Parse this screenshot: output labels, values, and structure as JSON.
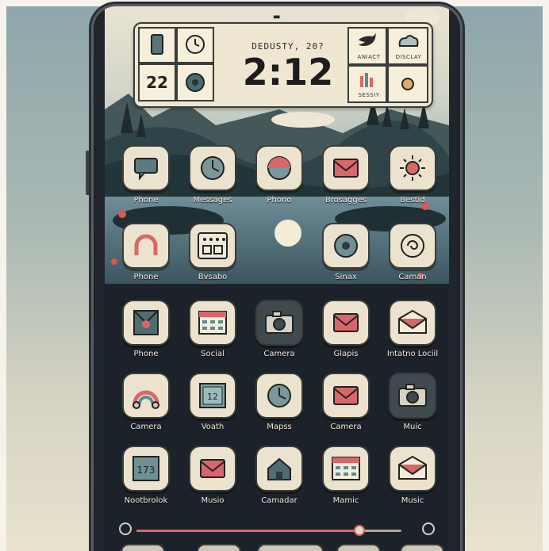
{
  "widget": {
    "date": "DEDUSTY, 20?",
    "time": "2:12",
    "calendar_day": "22",
    "right_top_label": "ANIACT",
    "right_top2_label": "DISCLAY",
    "right_bottom_label": "SESSIY"
  },
  "rows": [
    [
      {
        "label": "Phone",
        "icon": "chat-bubble-icon"
      },
      {
        "label": "Messages",
        "icon": "clock-icon"
      },
      {
        "label": "Phono",
        "icon": "sunset-icon"
      },
      {
        "label": "Brosagges",
        "icon": "mail-icon"
      },
      {
        "label": "Bestid",
        "icon": "sun-icon"
      }
    ],
    [
      {
        "label": "Phone",
        "icon": "arch-icon"
      },
      {
        "label": "Bvsabo",
        "icon": "keypad-icon"
      },
      {
        "label": "",
        "icon": ""
      },
      {
        "label": "Sinax",
        "icon": "target-icon"
      },
      {
        "label": "Caman",
        "icon": "spiral-icon"
      }
    ],
    [
      {
        "label": "Phone",
        "icon": "envelope-red-icon"
      },
      {
        "label": "Social",
        "icon": "calendar-icon"
      },
      {
        "label": "Camera",
        "icon": "camera-icon"
      },
      {
        "label": "Glapis",
        "icon": "mail-icon"
      },
      {
        "label": "Intatno Lociil",
        "icon": "envelope-open-icon"
      }
    ],
    [
      {
        "label": "Camera",
        "icon": "rainbow-icon"
      },
      {
        "label": "Voath",
        "icon": "calendar-note-icon"
      },
      {
        "label": "Mapss",
        "icon": "clock-icon"
      },
      {
        "label": "Camera",
        "icon": "mail-icon"
      },
      {
        "label": "Muic",
        "icon": "camera-icon"
      }
    ],
    [
      {
        "label": "Nootbrolok",
        "icon": "notebook-icon"
      },
      {
        "label": "Musio",
        "icon": "mail-icon"
      },
      {
        "label": "Camadar",
        "icon": "house-icon"
      },
      {
        "label": "Mamic",
        "icon": "calendar-icon"
      },
      {
        "label": "Music",
        "icon": "envelope-open-icon"
      }
    ]
  ],
  "progress": 0.84,
  "colors": {
    "accent": "#d8676a",
    "icon_bg": "#ece3cf",
    "screen": "#1b2026"
  }
}
